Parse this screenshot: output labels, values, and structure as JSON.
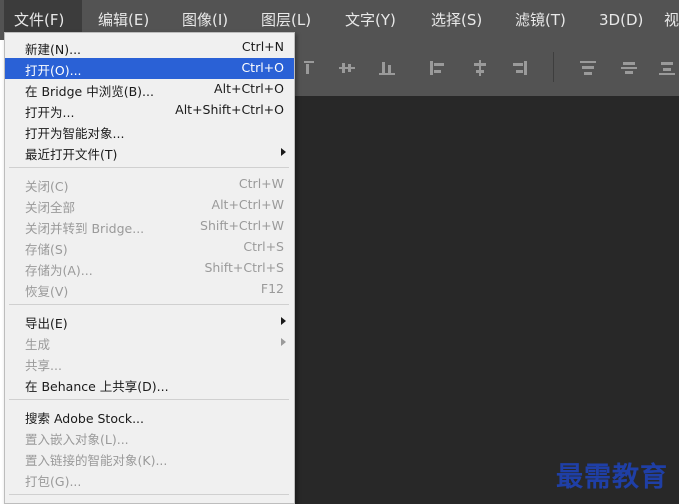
{
  "menubar": {
    "items": [
      {
        "label": "文件(F)"
      },
      {
        "label": "编辑(E)"
      },
      {
        "label": "图像(I)"
      },
      {
        "label": "图层(L)"
      },
      {
        "label": "文字(Y)"
      },
      {
        "label": "选择(S)"
      },
      {
        "label": "滤镜(T)"
      },
      {
        "label": "3D(D)"
      },
      {
        "label": "视"
      }
    ]
  },
  "file_menu": {
    "items": [
      {
        "label": "新建(N)...",
        "shortcut": "Ctrl+N"
      },
      {
        "label": "打开(O)...",
        "shortcut": "Ctrl+O"
      },
      {
        "label": "在 Bridge 中浏览(B)...",
        "shortcut": "Alt+Ctrl+O"
      },
      {
        "label": "打开为...",
        "shortcut": "Alt+Shift+Ctrl+O"
      },
      {
        "label": "打开为智能对象..."
      },
      {
        "label": "最近打开文件(T)"
      },
      {
        "label": "关闭(C)",
        "shortcut": "Ctrl+W"
      },
      {
        "label": "关闭全部",
        "shortcut": "Alt+Ctrl+W"
      },
      {
        "label": "关闭并转到 Bridge...",
        "shortcut": "Shift+Ctrl+W"
      },
      {
        "label": "存储(S)",
        "shortcut": "Ctrl+S"
      },
      {
        "label": "存储为(A)...",
        "shortcut": "Shift+Ctrl+S"
      },
      {
        "label": "恢复(V)",
        "shortcut": "F12"
      },
      {
        "label": "导出(E)"
      },
      {
        "label": "生成"
      },
      {
        "label": "共享..."
      },
      {
        "label": "在 Behance 上共享(D)..."
      },
      {
        "label": "搜索 Adobe Stock..."
      },
      {
        "label": "置入嵌入对象(L)..."
      },
      {
        "label": "置入链接的智能对象(K)..."
      },
      {
        "label": "打包(G)..."
      }
    ]
  },
  "watermark": {
    "text": "最需教育"
  },
  "colors": {
    "menubar": "#535353",
    "canvas": "#282828",
    "highlight": "#2a61d6",
    "menu_bg": "#f0f0f0",
    "watermark": "#1f3fa6"
  }
}
